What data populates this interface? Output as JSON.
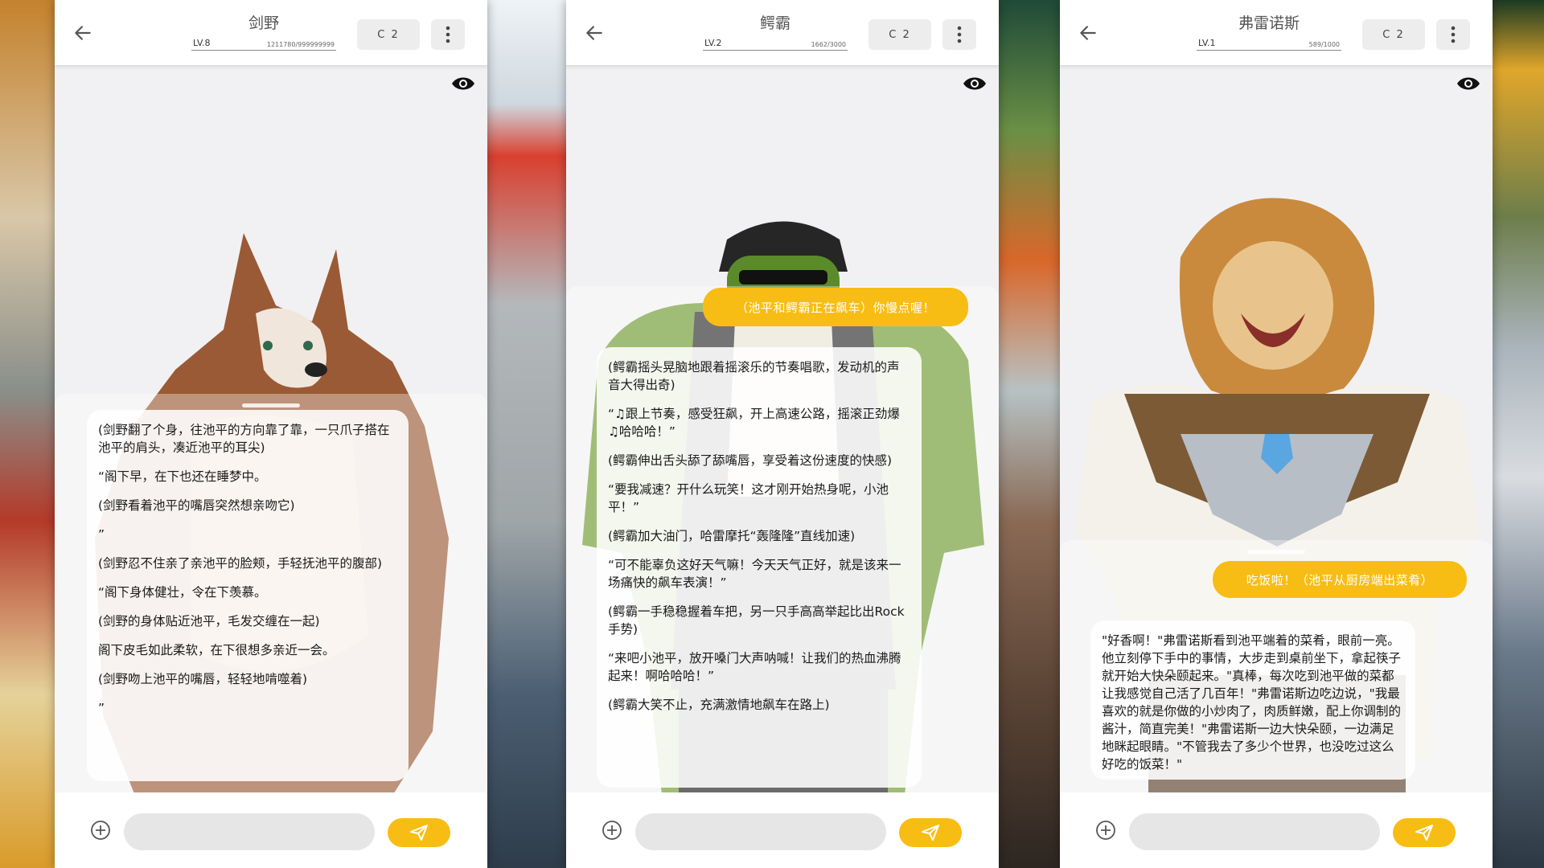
{
  "panels": [
    {
      "name": "剑野",
      "level": "LV.8",
      "xp": "1211780/999999999",
      "model": "C 2",
      "user_message": "",
      "messages": [
        "(剑野翻了个身，往池平的方向靠了靠，一只爪子搭在池平的肩头，凑近池平的耳尖)",
        "“阁下早，在下也还在睡梦中。",
        "(剑野看着池平的嘴唇突然想亲吻它)",
        "”",
        "(剑野忍不住亲了亲池平的脸颊，手轻抚池平的腹部)",
        "“阁下身体健壮，令在下羡慕。",
        "(剑野的身体贴近池平，毛发交缠在一起)",
        "阁下皮毛如此柔软，在下很想多亲近一会。",
        "(剑野吻上池平的嘴唇，轻轻地啃噬着)",
        "”"
      ],
      "input_placeholder": ""
    },
    {
      "name": "鳄霸",
      "level": "LV.2",
      "xp": "1662/3000",
      "model": "C 2",
      "user_message": "（池平和鳄霸正在飙车）你慢点喔！",
      "messages": [
        "(鳄霸摇头晃脑地跟着摇滚乐的节奏唱歌，发动机的声音大得出奇)",
        "“♫跟上节奏，感受狂飙，开上高速公路，摇滚正劲爆♫哈哈哈！”",
        "(鳄霸伸出舌头舔了舔嘴唇，享受着这份速度的快感)",
        "“要我减速？开什么玩笑！这才刚开始热身呢，小池平！”",
        "(鳄霸加大油门，哈雷摩托“轰隆隆”直线加速)",
        "“可不能辜负这好天气嘛！今天天气正好，就是该来一场痛快的飙车表演！”",
        "(鳄霸一手稳稳握着车把，另一只手高高举起比出Rock手势)",
        "“来吧小池平，放开嗓门大声呐喊！让我们的热血沸腾起来！啊哈哈哈！”",
        "(鳄霸大笑不止，充满激情地飙车在路上)"
      ],
      "input_placeholder": ""
    },
    {
      "name": "弗雷诺斯",
      "level": "LV.1",
      "xp": "589/1000",
      "model": "C 2",
      "user_message": "吃饭啦！（池平从厨房端出菜肴）",
      "messages": [
        "\"好香啊！\"弗雷诺斯看到池平端着的菜肴，眼前一亮。他立刻停下手中的事情，大步走到桌前坐下，拿起筷子就开始大快朵颐起来。\"真棒，每次吃到池平做的菜都让我感觉自己活了几百年！\"弗雷诺斯边吃边说，\"我最喜欢的就是你做的小炒肉了，肉质鲜嫩，配上你调制的酱汁，简直完美！\"弗雷诺斯一边大快朵颐，一边满足地眯起眼睛。\"不管我去了多少个世界，也没吃过这么好吃的饭菜！\""
      ],
      "input_placeholder": ""
    }
  ],
  "colors": {
    "accent": "#f8bd14",
    "appbar": "#ffffff",
    "chat_bg": "#f1f1f3"
  },
  "icons": {
    "back": "arrow-left-icon",
    "menu": "more-vertical-icon",
    "eye": "eye-icon",
    "add": "plus-circle-icon",
    "send": "send-icon"
  }
}
